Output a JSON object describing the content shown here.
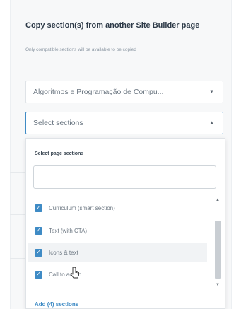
{
  "dialog": {
    "title": "Copy section(s) from another Site Builder page",
    "subtitle": "Only compatible sections will be available to be copied"
  },
  "page_select": {
    "value": "Algoritmos e Programação de Compu...",
    "arrow_icon": "caret-down-icon"
  },
  "sections_select": {
    "placeholder": "Select sections",
    "arrow_icon": "caret-up-icon"
  },
  "dropdown": {
    "label": "Select page sections",
    "search_value": "",
    "items": [
      {
        "label": "Curriculum (smart section)",
        "checked": true
      },
      {
        "label": "Text (with CTA)",
        "checked": true
      },
      {
        "label": "Icons & text",
        "checked": true
      },
      {
        "label": "Call to action",
        "checked": true
      }
    ],
    "add_link": "Add (4) sections"
  },
  "colors": {
    "accent": "#3f8bc5",
    "panel_bg": "#f7f8f9",
    "text": "#2d3a48",
    "muted": "#8b97a3"
  }
}
